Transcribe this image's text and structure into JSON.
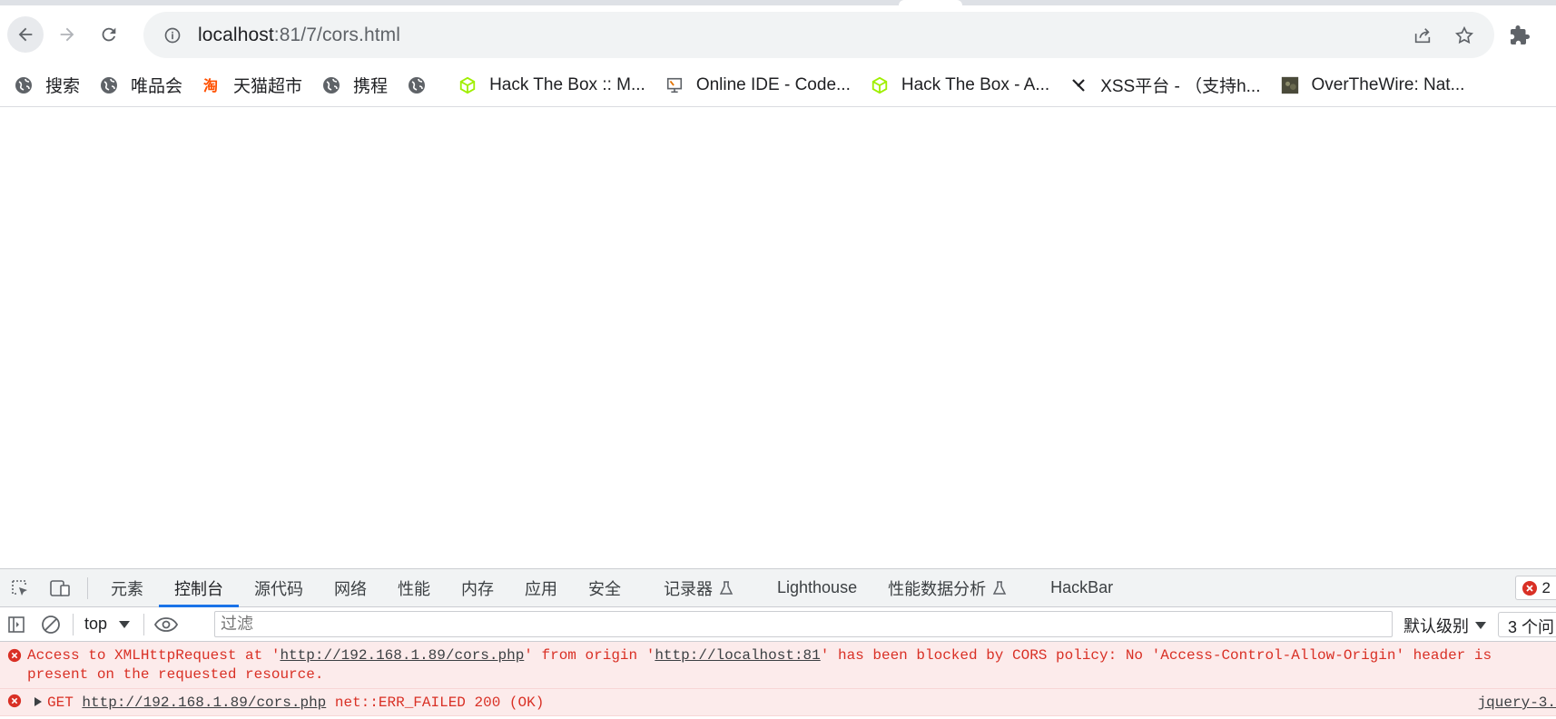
{
  "browser": {
    "url_host": "localhost",
    "url_rest": ":81/7/cors.html"
  },
  "bookmarks": [
    {
      "label": "搜索",
      "icon": "globe-icon"
    },
    {
      "label": "唯品会",
      "icon": "globe-icon"
    },
    {
      "label": "天猫超市",
      "icon": "taobao-icon"
    },
    {
      "label": "携程",
      "icon": "globe-icon"
    },
    {
      "label": "",
      "icon": "globe-icon"
    },
    {
      "label": "Hack The Box :: M...",
      "icon": "hackthebox-icon"
    },
    {
      "label": "Online IDE - Code...",
      "icon": "monitor-icon"
    },
    {
      "label": "Hack The Box - A...",
      "icon": "hackthebox-icon"
    },
    {
      "label": "XSS平台 - （支持h...",
      "icon": "xss-icon"
    },
    {
      "label": "OverTheWire: Nat...",
      "icon": "overthewire-icon"
    }
  ],
  "devtools": {
    "tabs": [
      "元素",
      "控制台",
      "源代码",
      "网络",
      "性能",
      "内存",
      "应用",
      "安全",
      "记录器",
      "Lighthouse",
      "性能数据分析",
      "HackBar"
    ],
    "active_tab": "控制台",
    "error_count": "2",
    "context": "top",
    "filter_placeholder": "过滤",
    "levels_label": "默认级别",
    "issues_label": "3 个问"
  },
  "console": {
    "msg1": {
      "pre": "Access to XMLHttpRequest at '",
      "link1": "http://192.168.1.89/cors.php",
      "mid": "' from origin '",
      "link2": "http://localhost:81",
      "post": "' has been blocked by CORS policy: No 'Access-Control-Allow-Origin' header is present on the requested resource."
    },
    "msg2": {
      "method": "GET",
      "link": "http://192.168.1.89/cors.php",
      "status": "net::ERR_FAILED 200 (OK)",
      "source": "jquery-3."
    }
  },
  "colors": {
    "error_red": "#d93025",
    "accent_blue": "#1a73e8",
    "error_bg": "#fcebeb"
  }
}
